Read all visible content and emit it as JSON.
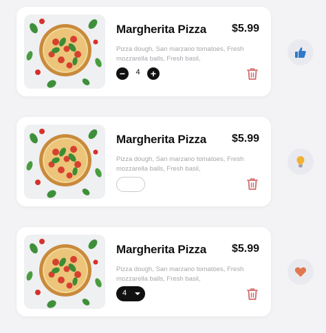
{
  "items": [
    {
      "name": "Margherita Pizza",
      "price": "$5.99",
      "description": "Pizza dough, San marzano tomatoes, Fresh mozzarella balls, Fresh basil,",
      "image_icon": "pizza-icon",
      "quantity_control": "stepper",
      "quantity": "4",
      "minus_symbol": "−",
      "plus_symbol": "+"
    },
    {
      "name": "Margherita Pizza",
      "price": "$5.99",
      "description": "Pizza dough, San marzano tomatoes, Fresh mozzarella balls, Fresh basil,",
      "image_icon": "pizza-icon",
      "quantity_control": "input",
      "quantity": ""
    },
    {
      "name": "Margherita Pizza",
      "price": "$5.99",
      "description": "Pizza dough, San marzano tomatoes, Fresh mozzarella balls, Fresh basil,",
      "image_icon": "pizza-icon",
      "quantity_control": "dropdown",
      "quantity": "4"
    }
  ],
  "reactions": [
    {
      "icon": "thumbs-up-icon",
      "color": "#2f79c8"
    },
    {
      "icon": "lightbulb-icon",
      "color": "#f2b134"
    },
    {
      "icon": "heart-icon",
      "color": "#e0774f"
    }
  ],
  "colors": {
    "background": "#f3f3f5",
    "card": "#ffffff",
    "text": "#111111",
    "muted_text": "#a7a7ad",
    "trash": "#d46a6a",
    "control_dark": "#111111"
  }
}
